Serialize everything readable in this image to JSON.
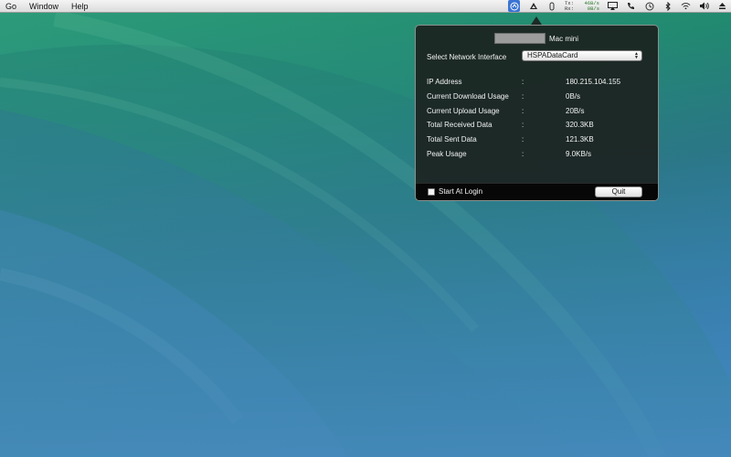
{
  "menubar": {
    "left_items": [
      "Go",
      "Window",
      "Help"
    ],
    "netspeed": {
      "tx_label": "Tx:",
      "tx_value": "46B/s",
      "rx_label": "Rx:",
      "rx_value": "0B/s"
    },
    "icons": [
      "network-monitor-icon",
      "google-drive-icon",
      "paperclip-icon",
      "airplay-icon",
      "phone-icon",
      "time-machine-icon",
      "bluetooth-icon",
      "wifi-icon",
      "volume-icon",
      "eject-icon"
    ]
  },
  "panel": {
    "host_name": "Mac mini",
    "interface_label": "Select Network Interface",
    "interface_value": "HSPADataCard",
    "separator": ":",
    "stats": [
      {
        "label": "IP Address",
        "value": "180.215.104.155"
      },
      {
        "label": "Current Download Usage",
        "value": "0B/s"
      },
      {
        "label": "Current Upload Usage",
        "value": "20B/s"
      },
      {
        "label": "Total Received Data",
        "value": "320.3KB"
      },
      {
        "label": "Total Sent Data",
        "value": "121.3KB"
      },
      {
        "label": "Peak Usage",
        "value": "9.0KB/s"
      }
    ],
    "start_at_login_label": "Start At Login",
    "start_at_login_checked": false,
    "quit_label": "Quit"
  },
  "colors": {
    "panel_background": "#1c2220",
    "menu_highlight": "#3a74d4",
    "netspeed_text": "#2a7a2a"
  }
}
